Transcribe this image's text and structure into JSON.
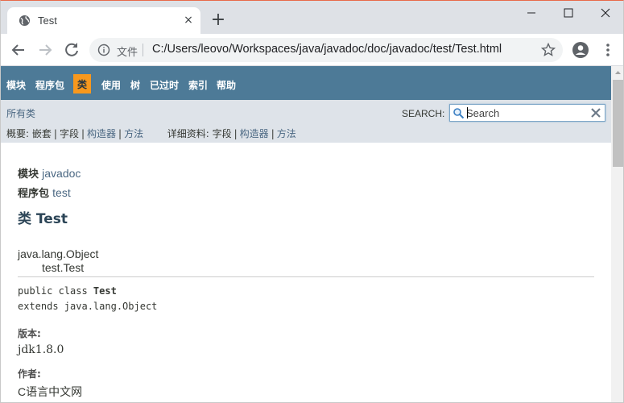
{
  "browser": {
    "tab_title": "Test",
    "new_tab": "+",
    "tab_close": "×",
    "omnibox_label": "文件",
    "url": "C:/Users/leovo/Workspaces/java/javadoc/doc/javadoc/test/Test.html"
  },
  "topnav": {
    "items": [
      "模块",
      "程序包",
      "类",
      "使用",
      "树",
      "已过时",
      "索引",
      "帮助"
    ],
    "active": "类",
    "active_color": "#f8981d",
    "background": "#4d7a97"
  },
  "subnav": {
    "all_classes": "所有类",
    "search_label": "SEARCH:",
    "search_placeholder": "Search",
    "summary_label": "概要:",
    "summary_nested": "嵌套",
    "summary_field": "字段",
    "summary_constructor": "构造器",
    "summary_method": "方法",
    "detail_label": "详细资料:",
    "detail_field": "字段",
    "detail_constructor": "构造器",
    "detail_method": "方法",
    "separator": "|"
  },
  "content": {
    "module_label": "模块",
    "module_name": "javadoc",
    "package_label": "程序包",
    "package_name": "test",
    "class_title": "类 Test",
    "inheritance_root": "java.lang.Object",
    "inheritance_class": "test.Test",
    "decl_prefix": "public class ",
    "decl_name": "Test",
    "decl_extends": "extends java.lang.Object",
    "version_label": "版本:",
    "version_value": "jdk1.8.0",
    "author_label": "作者:",
    "author_value": "C语言中文网"
  }
}
